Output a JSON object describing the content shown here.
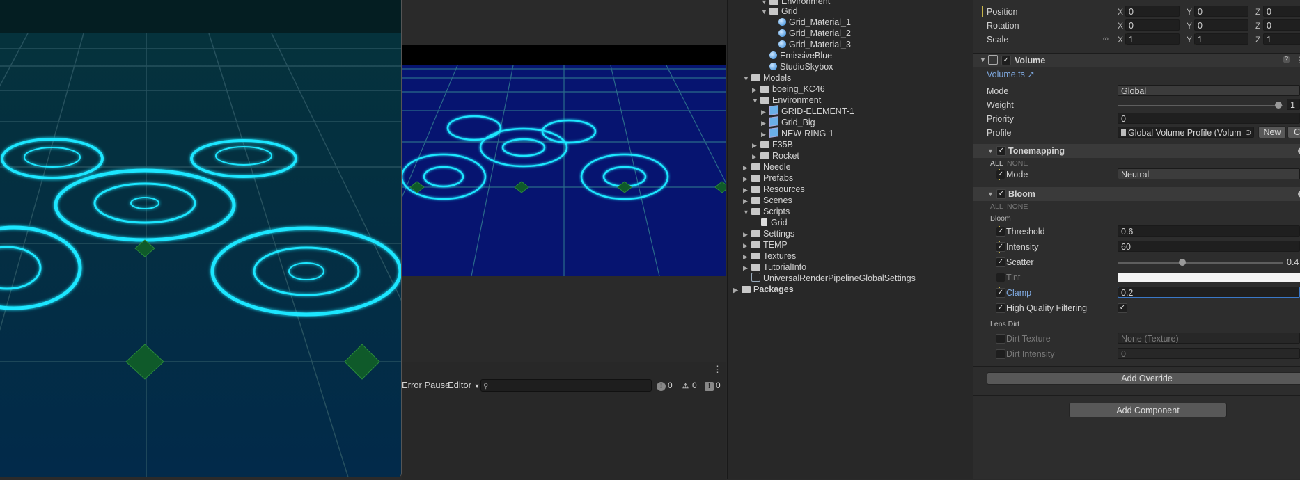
{
  "console": {
    "error_pause": "Error Pause",
    "editor": "Editor",
    "count_info": "0",
    "count_warn": "0",
    "count_error": "0"
  },
  "project": {
    "items": [
      {
        "label": "Environment",
        "type": "folder",
        "open": true
      },
      {
        "label": "Grid",
        "type": "folder",
        "open": true
      },
      {
        "label": "Grid_Material_1",
        "type": "material"
      },
      {
        "label": "Grid_Material_2",
        "type": "material"
      },
      {
        "label": "Grid_Material_3",
        "type": "material"
      },
      {
        "label": "EmissiveBlue",
        "type": "material"
      },
      {
        "label": "StudioSkybox",
        "type": "material"
      },
      {
        "label": "Models",
        "type": "folder",
        "open": true
      },
      {
        "label": "boeing_KC46",
        "type": "folder"
      },
      {
        "label": "Environment",
        "type": "folder",
        "open": true
      },
      {
        "label": "GRID-ELEMENT-1",
        "type": "prefab"
      },
      {
        "label": "Grid_Big",
        "type": "prefab"
      },
      {
        "label": "NEW-RING-1",
        "type": "prefab"
      },
      {
        "label": "F35B",
        "type": "folder"
      },
      {
        "label": "Rocket",
        "type": "folder"
      },
      {
        "label": "Needle",
        "type": "folder"
      },
      {
        "label": "Prefabs",
        "type": "folder"
      },
      {
        "label": "Resources",
        "type": "folder"
      },
      {
        "label": "Scenes",
        "type": "folder"
      },
      {
        "label": "Scripts",
        "type": "folder",
        "open": true
      },
      {
        "label": "Grid",
        "type": "script"
      },
      {
        "label": "Settings",
        "type": "folder"
      },
      {
        "label": "TEMP",
        "type": "folder"
      },
      {
        "label": "Textures",
        "type": "folder"
      },
      {
        "label": "TutorialInfo",
        "type": "folder"
      },
      {
        "label": "UniversalRenderPipelineGlobalSettings",
        "type": "asset"
      },
      {
        "label": "Packages",
        "type": "folder"
      }
    ]
  },
  "transform": {
    "position_label": "Position",
    "rotation_label": "Rotation",
    "scale_label": "Scale",
    "x": "X",
    "y": "Y",
    "z": "Z",
    "position": [
      "0",
      "0",
      "0"
    ],
    "rotation": [
      "0",
      "0",
      "0"
    ],
    "scale": [
      "1",
      "1",
      "1"
    ]
  },
  "volume": {
    "title": "Volume",
    "script_link": "Volume.ts",
    "mode_label": "Mode",
    "mode_value": "Global",
    "weight_label": "Weight",
    "weight_value": "1",
    "priority_label": "Priority",
    "priority_value": "0",
    "profile_label": "Profile",
    "profile_value": "Global Volume Profile (Volum",
    "new_button": "New",
    "clone_button": "Cl"
  },
  "tonemapping": {
    "title": "Tonemapping",
    "all": "ALL",
    "none": "NONE",
    "mode_label": "Mode",
    "mode_value": "Neutral"
  },
  "bloom": {
    "title": "Bloom",
    "all": "ALL",
    "none": "NONE",
    "section": "Bloom",
    "threshold_label": "Threshold",
    "threshold_value": "0.6",
    "intensity_label": "Intensity",
    "intensity_value": "60",
    "scatter_label": "Scatter",
    "scatter_value": "0.4",
    "tint_label": "Tint",
    "clamp_label": "Clamp",
    "clamp_value": "0.2",
    "hq_label": "High Quality Filtering",
    "lens_section": "Lens Dirt",
    "dirt_texture_label": "Dirt Texture",
    "dirt_texture_value": "None (Texture)",
    "dirt_intensity_label": "Dirt Intensity",
    "dirt_intensity_value": "0"
  },
  "buttons": {
    "add_override": "Add Override",
    "add_component": "Add Component"
  },
  "colors": {
    "accent_link": "#7fa9e0",
    "neon": "#1ee6ff",
    "modified_marker": "#c7b54a"
  }
}
